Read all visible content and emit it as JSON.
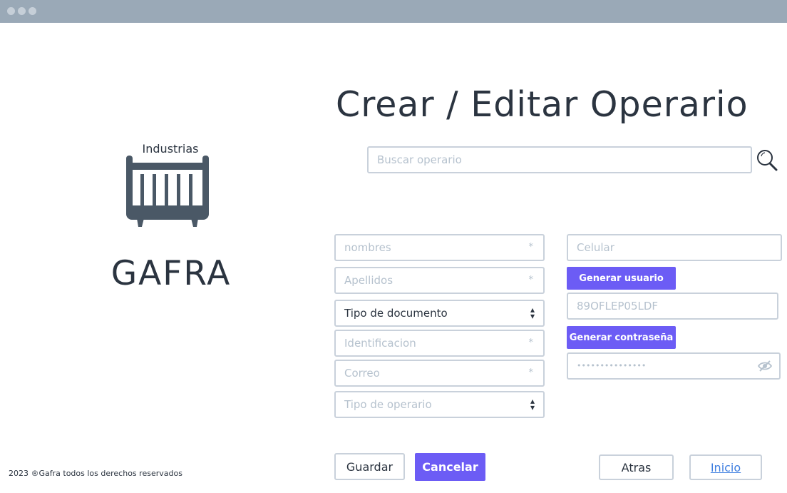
{
  "window": {
    "controls": [
      "close-dot",
      "minimize-dot",
      "maximize-dot"
    ]
  },
  "brand": {
    "top_text": "Industrias",
    "name": "GAFRA",
    "logo_icon": "crib-icon"
  },
  "page": {
    "title": "Crear / Editar Operario"
  },
  "search": {
    "placeholder": "Buscar operario",
    "icon": "search-icon"
  },
  "form": {
    "nombres": {
      "placeholder": "nombres",
      "required_mark": "*"
    },
    "apellidos": {
      "placeholder": "Apellidos",
      "required_mark": "*"
    },
    "tipo_documento": {
      "value": "Tipo de documento"
    },
    "identificacion": {
      "placeholder": "Identificacion",
      "required_mark": "*"
    },
    "correo": {
      "placeholder": "Correo",
      "required_mark": "*"
    },
    "tipo_operario": {
      "value": "Tipo de operario"
    },
    "celular": {
      "placeholder": "Celular"
    },
    "generar_usuario_label": "Generar usuario",
    "usuario": {
      "value": "89OFLEP05LDF"
    },
    "generar_contrasena_label": "Generar contraseña",
    "contrasena": {
      "value": "•••••••••••••••",
      "icon": "eye-off-icon"
    }
  },
  "actions": {
    "guardar_label": "Guardar",
    "cancelar_label": "Cancelar",
    "atras_label": "Atras",
    "inicio_label": "Inicio"
  },
  "footer": {
    "text": "2023 ®Gafra todos los derechos reservados"
  },
  "colors": {
    "accent": "#6c5cf5",
    "titlebar": "#9aa9b7",
    "text": "#2b3440",
    "border": "#c9d1db",
    "placeholder": "#b6c2ce"
  }
}
